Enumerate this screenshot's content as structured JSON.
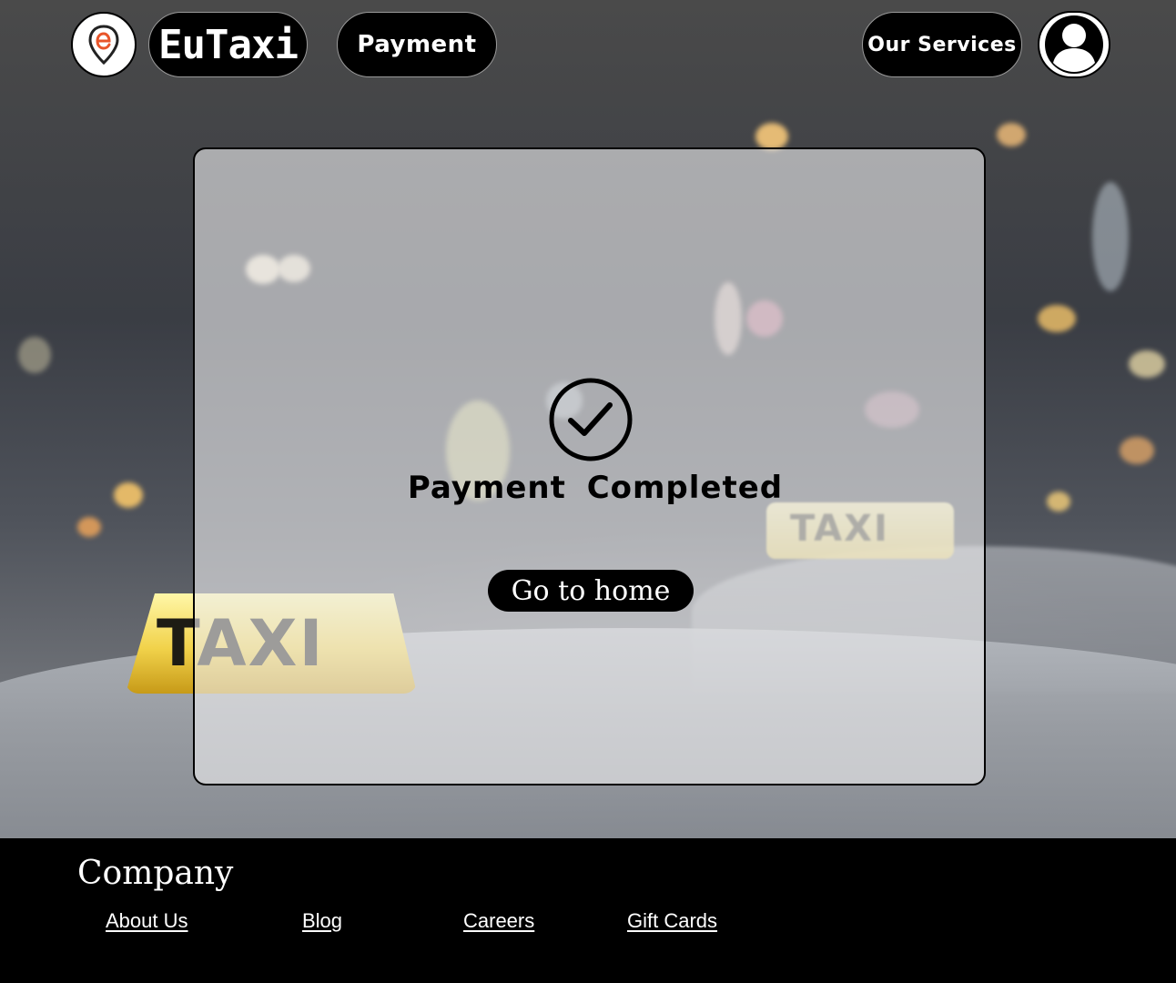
{
  "header": {
    "brand_name": "EuTaxi",
    "logo_icon": "location-pin-e-icon",
    "nav": {
      "payment_label": "Payment",
      "services_label": "Our Services"
    },
    "avatar_icon": "user-avatar-icon"
  },
  "main": {
    "status_icon": "check-circle-icon",
    "title": "Payment Completed",
    "home_button_label": "Go to home"
  },
  "footer": {
    "heading": "Company",
    "links": [
      "About Us",
      "Blog",
      "Careers",
      "Gift Cards"
    ]
  },
  "colors": {
    "header_pill": "#000000",
    "card_overlay": "rgba(235,236,238,0.62)",
    "footer_bg": "#000000",
    "logo_accent": "#e8552a",
    "taxi_sign": "#f1d24a"
  }
}
